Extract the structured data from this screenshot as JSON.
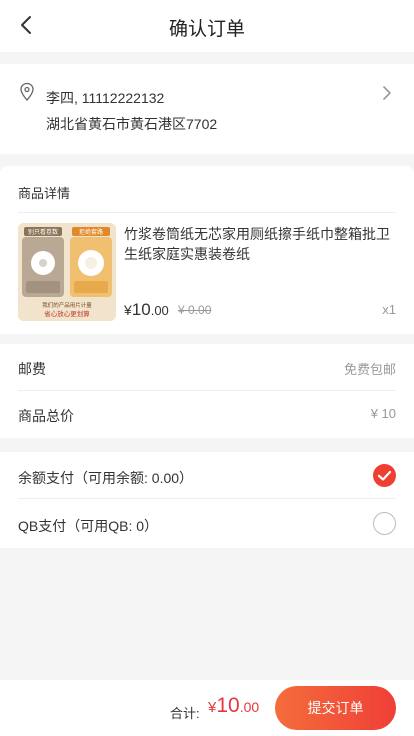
{
  "nav": {
    "title": "确认订单"
  },
  "address": {
    "name_phone": "李四, 11112222132",
    "detail": "湖北省黄石市黄石港区7702"
  },
  "goods": {
    "header": "商品详情",
    "product": {
      "name": "竹浆卷筒纸无芯家用厕纸擦手纸巾整箱批卫生纸家庭实惠装卷纸",
      "price_currency": "¥",
      "price_int": "10",
      "price_dec": ".00",
      "old_price": "¥ 0.00",
      "quantity": "x1",
      "image_texts": {
        "left_tag": "别只看卷数",
        "right_tag": "拒绝套路",
        "bottom_line1": "我们的产品用片计量",
        "bottom_line2": "省心放心更划算"
      }
    }
  },
  "fees": {
    "shipping_label": "邮费",
    "shipping_value": "免费包邮",
    "subtotal_label": "商品总价",
    "subtotal_value": "¥ 10"
  },
  "payment": {
    "balance_label": "余额支付（可用余额: 0.00）",
    "balance_selected": true,
    "qb_label": "QB支付（可用QB: 0）",
    "qb_selected": false
  },
  "bottom": {
    "total_label": "合计:",
    "total_currency": "¥",
    "total_int": "10",
    "total_dec": ".00",
    "submit_label": "提交订单"
  },
  "colors": {
    "accent": "#ef3f32",
    "price_red": "#e5383f"
  }
}
